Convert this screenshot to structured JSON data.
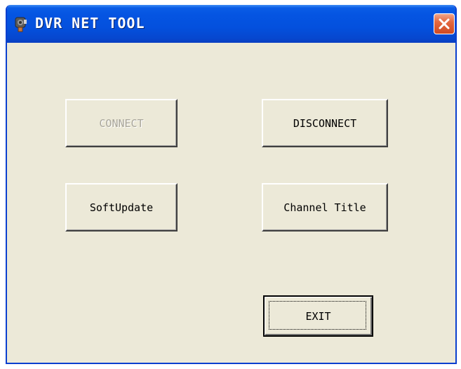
{
  "window": {
    "title": "DVR NET TOOL",
    "icon": "dvr-app-icon",
    "close_icon": "close-icon",
    "close_color": "#d9552e",
    "titlebar_color": "#0555e2",
    "background_color": "#ece9d8"
  },
  "buttons": {
    "connect": {
      "label": "CONNECT",
      "enabled": false
    },
    "disconnect": {
      "label": "DISCONNECT",
      "enabled": true
    },
    "softupdate": {
      "label": "SoftUpdate",
      "enabled": true
    },
    "channel_title": {
      "label": "Channel Title",
      "enabled": true
    },
    "exit": {
      "label": "EXIT",
      "enabled": true,
      "default": true
    }
  }
}
